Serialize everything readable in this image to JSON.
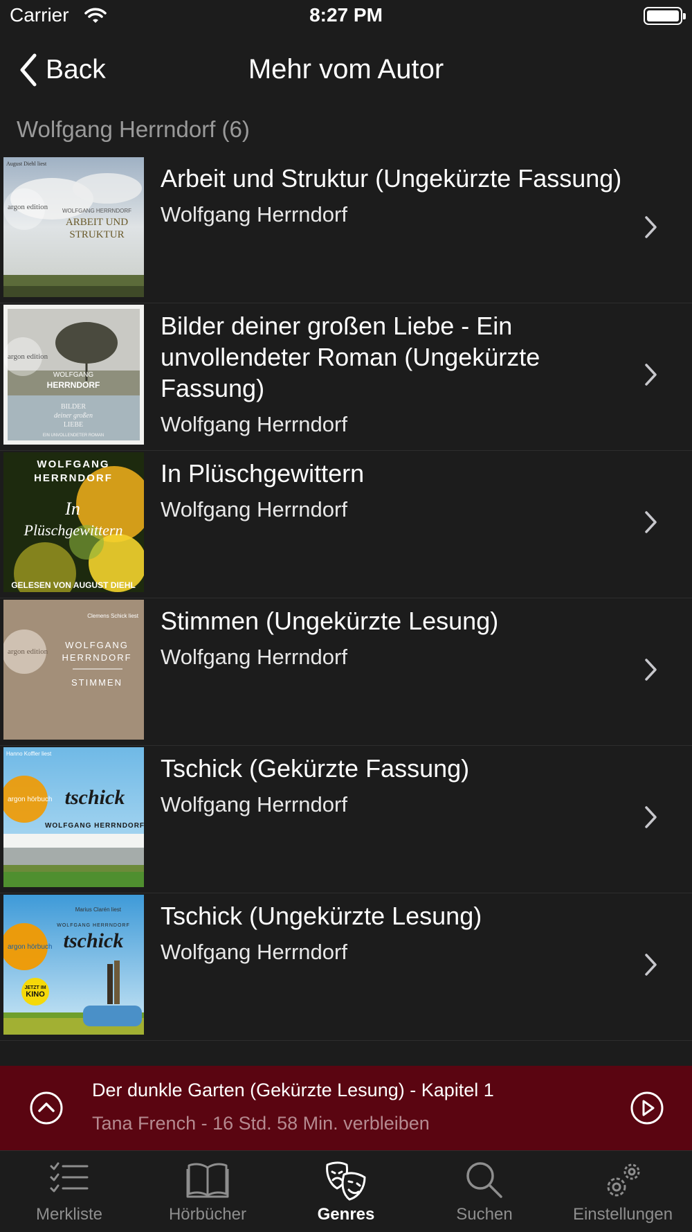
{
  "status_bar": {
    "carrier": "Carrier",
    "time": "8:27 PM"
  },
  "nav": {
    "back_label": "Back",
    "title": "Mehr vom Autor"
  },
  "section": {
    "header": "Wolfgang Herrndorf (6)"
  },
  "books": [
    {
      "title": "Arbeit und Struktur (Ungekürzte Fassung)",
      "author": "Wolfgang Herrndorf",
      "cover": {
        "narrator": "August Diehl liest",
        "publisher": "argon edition",
        "author": "WOLFGANG HERRNDORF",
        "title_line1": "ARBEIT UND",
        "title_line2": "STRUKTUR"
      }
    },
    {
      "title": "Bilder deiner großen Liebe - Ein unvollendeter Roman (Ungekürzte Fassung)",
      "author": "Wolfgang Herrndorf",
      "cover": {
        "publisher": "argon edition",
        "author_line1": "WOLFGANG",
        "author_line2": "HERRNDORF",
        "title_line1": "BILDER",
        "title_line2": "deiner großen",
        "title_line3": "LIEBE",
        "subtitle": "EIN UNVOLLENDETER ROMAN"
      }
    },
    {
      "title": "In Plüschgewittern",
      "author": "Wolfgang Herrndorf",
      "cover": {
        "author_line1": "WOLFGANG",
        "author_line2": "HERRNDORF",
        "title_line1": "In",
        "title_line2": "Plüschgewittern",
        "reader": "GELESEN VON AUGUST DIEHL"
      }
    },
    {
      "title": "Stimmen (Ungekürzte Lesung)",
      "author": "Wolfgang Herrndorf",
      "cover": {
        "narrator": "Clemens Schick liest",
        "publisher": "argon edition",
        "author_line1": "WOLFGANG",
        "author_line2": "HERRNDORF",
        "title": "STIMMEN"
      }
    },
    {
      "title": "Tschick (Gekürzte Fassung)",
      "author": "Wolfgang Herrndorf",
      "cover": {
        "narrator": "Hanno Koffler liest",
        "publisher": "argon hörbuch",
        "title": "tschick",
        "author": "WOLFGANG HERRNDORF"
      }
    },
    {
      "title": "Tschick (Ungekürzte Lesung)",
      "author": "Wolfgang Herrndorf",
      "cover": {
        "narrator": "Marius Clarén liest",
        "publisher": "argon hörbuch",
        "author": "WOLFGANG HERRNDORF",
        "title": "tschick",
        "badge_line1": "JETZT IM",
        "badge_line2": "KINO"
      }
    }
  ],
  "now_playing": {
    "title": "Der dunkle Garten (Gekürzte Lesung) - Kapitel 1",
    "subtitle": "Tana French - 16 Std. 58 Min. verbleiben",
    "background_color": "#5a0511"
  },
  "tabs": [
    {
      "label": "Merkliste",
      "icon": "list-icon",
      "active": false
    },
    {
      "label": "Hörbücher",
      "icon": "book-icon",
      "active": false
    },
    {
      "label": "Genres",
      "icon": "theater-masks-icon",
      "active": true
    },
    {
      "label": "Suchen",
      "icon": "search-icon",
      "active": false
    },
    {
      "label": "Einstellungen",
      "icon": "gears-icon",
      "active": false
    }
  ],
  "colors": {
    "background": "#1c1c1c",
    "mini_player": "#5a0511",
    "inactive_tab": "#8e8e8e",
    "section_header": "#9a9a9a"
  }
}
